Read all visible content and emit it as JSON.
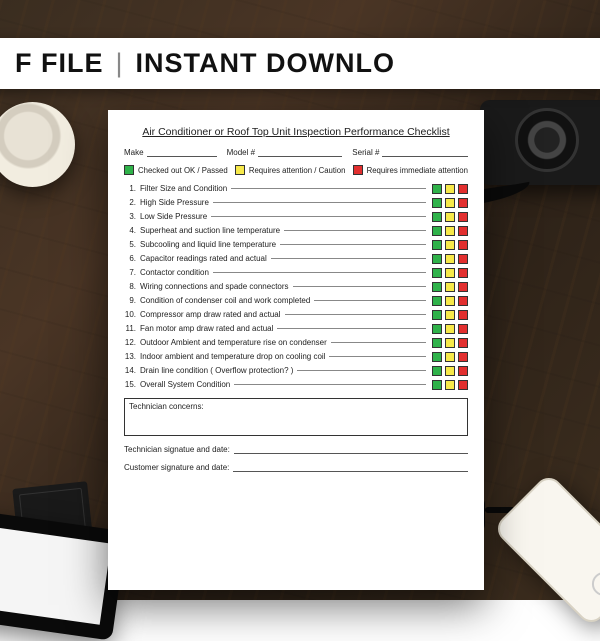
{
  "banner": {
    "left": "F FILE",
    "right": "INSTANT DOWNLO"
  },
  "doc": {
    "title": "Air Conditioner or Roof Top Unit Inspection Performance Checklist",
    "fields": {
      "make": "Make",
      "model": "Model #",
      "serial": "Serial #"
    },
    "legend": {
      "passed": "Checked out OK / Passed",
      "caution": "Requires attention / Caution",
      "immediate": "Requires immediate attention"
    },
    "items": [
      "Filter Size and Condition",
      "High Side Pressure",
      "Low Side Pressure",
      "Superheat and suction line temperature",
      "Subcooling and liquid line temperature",
      "Capacitor readings rated and actual",
      "Contactor condition",
      "Wiring connections and spade connectors",
      "Condition of condenser coil and work completed",
      "Compressor amp draw rated and actual",
      "Fan motor amp draw rated and actual",
      "Outdoor Ambient and temperature rise on condenser",
      "Indoor ambient and temperature drop on cooling coil",
      "Drain line condition ( Overflow protection? )",
      "Overall System Condition"
    ],
    "concerns_label": "Technician concerns:",
    "tech_sig": "Technician signatue and date:",
    "cust_sig": "Customer signature and date:"
  },
  "colors": {
    "green": "#2fb24a",
    "yellow": "#f7e94a",
    "red": "#e22f2f"
  }
}
